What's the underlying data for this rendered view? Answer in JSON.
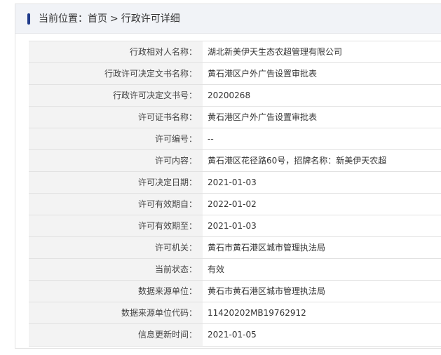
{
  "breadcrumb": {
    "prefix": "当前位置：",
    "home": "首页",
    "separator": ">",
    "current": "行政许可详细"
  },
  "details": [
    {
      "label": "行政相对人名称：",
      "value": "湖北新美伊天生态农超管理有限公司"
    },
    {
      "label": "行政许可决定文书名称：",
      "value": "黄石港区户外广告设置审批表"
    },
    {
      "label": "行政许可决定文书号：",
      "value": "20200268"
    },
    {
      "label": "许可证书名称：",
      "value": "黄石港区户外广告设置审批表"
    },
    {
      "label": "许可编号：",
      "value": "--"
    },
    {
      "label": "许可内容：",
      "value": "黄石港区花径路60号，招牌名称：新美伊天农超"
    },
    {
      "label": "许可决定日期：",
      "value": "2021-01-03"
    },
    {
      "label": "许可有效期自：",
      "value": "2022-01-02"
    },
    {
      "label": "许可有效期至：",
      "value": "2021-01-03"
    },
    {
      "label": "许可机关：",
      "value": "黄石市黄石港区城市管理执法局"
    },
    {
      "label": "当前状态：",
      "value": "有效"
    },
    {
      "label": "数据来源单位：",
      "value": "黄石市黄石港区城市管理执法局"
    },
    {
      "label": "数据来源单位代码：",
      "value": "11420202MB19762912"
    },
    {
      "label": "信息更新时间：",
      "value": "2021-01-05"
    }
  ],
  "colors": {
    "accent_bar": "#1f3a8a",
    "header_bg": "#f1f3f7",
    "label_bg": "#f3f3f3",
    "border": "#e2e2e2"
  }
}
